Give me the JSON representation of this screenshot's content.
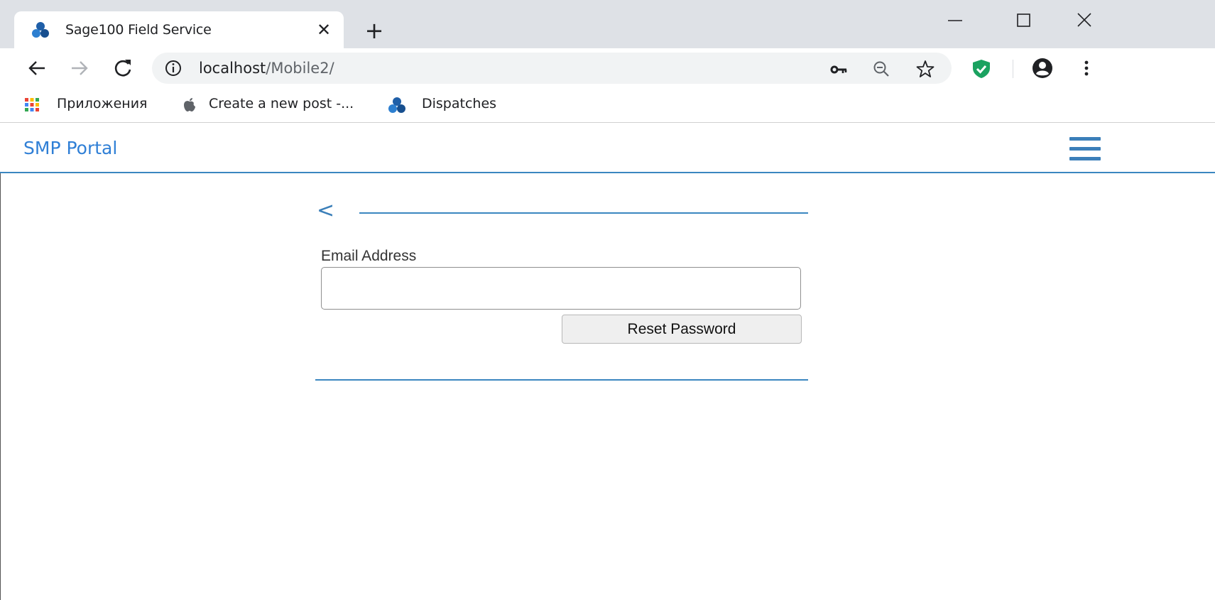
{
  "browser": {
    "tab": {
      "title": "Sage100 Field Service",
      "close_symbol": "✕"
    },
    "new_tab_symbol": "+",
    "address": {
      "host": "localhost",
      "path": "/Mobile2/"
    },
    "bookmarks": [
      {
        "label": "Приложения",
        "icon": "apps-grid-icon"
      },
      {
        "label": "Create a new post -...",
        "icon": "apple-icon"
      },
      {
        "label": "Dispatches",
        "icon": "sage-logo-icon"
      }
    ],
    "colors": {
      "tabstrip": "#dee1e6",
      "omnibox": "#f1f3f4",
      "shield": "#1aa260"
    }
  },
  "app": {
    "brand": "SMP Portal",
    "back_symbol": "<",
    "form": {
      "email_label": "Email Address",
      "email_value": "",
      "email_placeholder": "",
      "reset_button_label": "Reset Password"
    },
    "colors": {
      "accent": "#3b87c0",
      "brand_text": "#2f7fd6"
    }
  }
}
